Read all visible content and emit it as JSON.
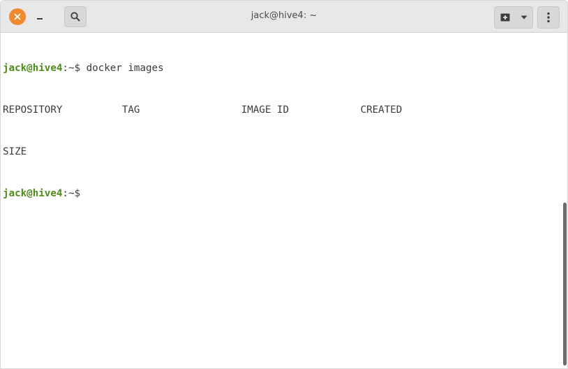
{
  "window": {
    "title": "jack@hive4: ~"
  },
  "icons": {
    "close": "close-icon",
    "minimize": "minimize-icon",
    "search": "search-icon",
    "new_tab": "new-tab-icon",
    "dropdown": "chevron-down-icon",
    "menu": "kebab-menu-icon"
  },
  "colors": {
    "close_button": "#f08a2c",
    "prompt_user": "#4e8b1a",
    "titlebar": "#e8e8e8"
  },
  "terminal": {
    "line1": {
      "user_host": "jack@hive4",
      "path": ":~$ ",
      "command": "docker images"
    },
    "line2": {
      "col1": "REPOSITORY          ",
      "col2": "TAG                 ",
      "col3": "IMAGE ID            ",
      "col4": "CREATED"
    },
    "line3": "SIZE",
    "line4": {
      "user_host": "jack@hive4",
      "path": ":~$"
    }
  }
}
